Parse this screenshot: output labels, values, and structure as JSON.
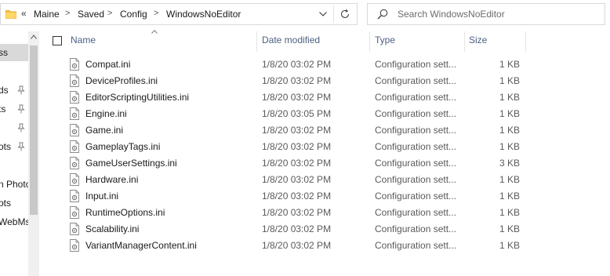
{
  "address_bar": {
    "overflow": "«",
    "breadcrumb": [
      "Maine",
      "Saved",
      "Config",
      "WindowsNoEditor"
    ],
    "separator": ">",
    "icons": {
      "folder": "folder-icon",
      "dropdown": "chevron-down-icon",
      "refresh": "refresh-icon"
    }
  },
  "search": {
    "placeholder": "Search WindowsNoEditor",
    "value": "",
    "icon": "search-icon"
  },
  "nav_pane": {
    "items": [
      {
        "label": "ss",
        "pinned": false,
        "selected": true
      },
      {
        "label": "ds",
        "pinned": true
      },
      {
        "label": "ts",
        "pinned": true
      },
      {
        "label": "",
        "pinned": true
      },
      {
        "label": "ots",
        "pinned": true
      },
      {
        "label": "n Photo",
        "pinned": false
      },
      {
        "label": "ots",
        "pinned": false
      },
      {
        "label": "WebMs",
        "pinned": false
      }
    ]
  },
  "columns": {
    "name": "Name",
    "date": "Date modified",
    "type": "Type",
    "size": "Size",
    "sorted_by": "name"
  },
  "files": [
    {
      "name": "Compat.ini",
      "date": "1/8/20 03:02 PM",
      "type": "Configuration sett...",
      "size": "1 KB"
    },
    {
      "name": "DeviceProfiles.ini",
      "date": "1/8/20 03:02 PM",
      "type": "Configuration sett...",
      "size": "1 KB"
    },
    {
      "name": "EditorScriptingUtilities.ini",
      "date": "1/8/20 03:02 PM",
      "type": "Configuration sett...",
      "size": "1 KB"
    },
    {
      "name": "Engine.ini",
      "date": "1/8/20 03:05 PM",
      "type": "Configuration sett...",
      "size": "1 KB"
    },
    {
      "name": "Game.ini",
      "date": "1/8/20 03:02 PM",
      "type": "Configuration sett...",
      "size": "1 KB"
    },
    {
      "name": "GameplayTags.ini",
      "date": "1/8/20 03:02 PM",
      "type": "Configuration sett...",
      "size": "1 KB"
    },
    {
      "name": "GameUserSettings.ini",
      "date": "1/8/20 03:02 PM",
      "type": "Configuration sett...",
      "size": "3 KB"
    },
    {
      "name": "Hardware.ini",
      "date": "1/8/20 03:02 PM",
      "type": "Configuration sett...",
      "size": "1 KB"
    },
    {
      "name": "Input.ini",
      "date": "1/8/20 03:02 PM",
      "type": "Configuration sett...",
      "size": "1 KB"
    },
    {
      "name": "RuntimeOptions.ini",
      "date": "1/8/20 03:02 PM",
      "type": "Configuration sett...",
      "size": "1 KB"
    },
    {
      "name": "Scalability.ini",
      "date": "1/8/20 03:02 PM",
      "type": "Configuration sett...",
      "size": "1 KB"
    },
    {
      "name": "VariantManagerContent.ini",
      "date": "1/8/20 03:02 PM",
      "type": "Configuration sett...",
      "size": "1 KB"
    }
  ],
  "colors": {
    "header_text": "#4d6082",
    "selected_nav": "#d9d9d9",
    "folder": "#f4c046"
  }
}
